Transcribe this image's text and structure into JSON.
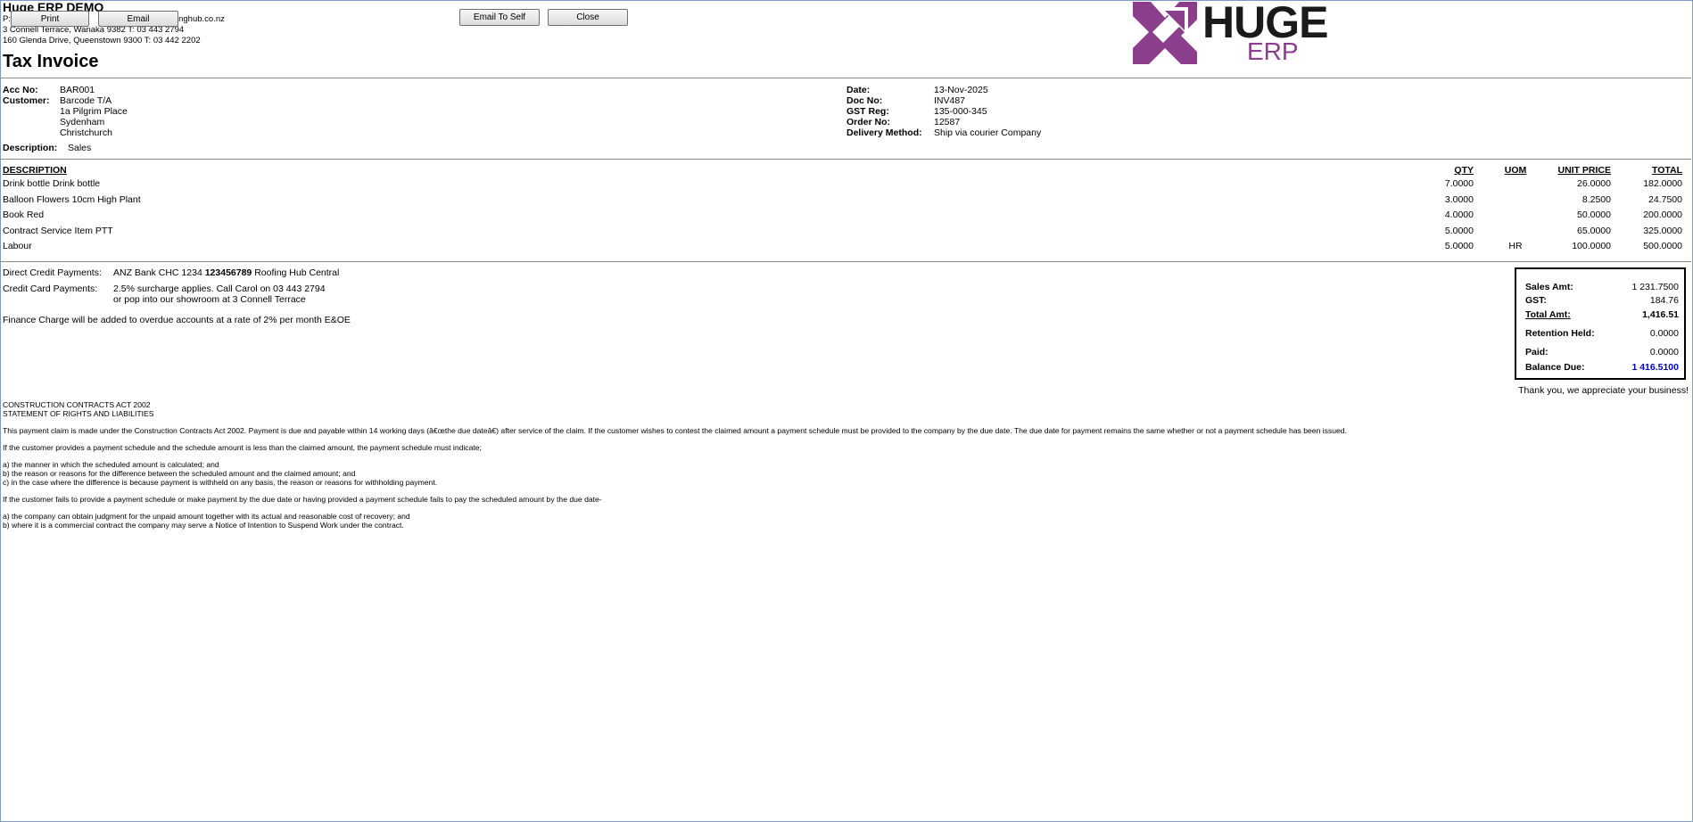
{
  "company": {
    "name": "Huge ERP DEMO",
    "line1_prefix": "P:",
    "line1_email": "inghub.co.nz",
    "line2": "3 Connell Terrace, Wanaka 9382  T: 03 443 2794",
    "line3": "160 Glenda Drive, Queenstown 9300  T: 03 442 2202"
  },
  "toolbar": {
    "print_label": "Print",
    "email_label": "Email",
    "email_self_label": "Email To Self",
    "close_label": "Close"
  },
  "logo": {
    "word1": "HUGE",
    "word2": "ERP",
    "brand_color": "#8b3e8b",
    "text_color": "#1a1a1a"
  },
  "doc_title": "Tax Invoice",
  "header_left": {
    "acc_label": "Acc No:",
    "acc_value": "BAR001",
    "customer_label": "Customer:",
    "customer_lines": [
      "Barcode T/A",
      "1a Pilgrim Place",
      "Sydenham",
      "Christchurch"
    ],
    "description_label": "Description:",
    "description_value": "Sales"
  },
  "header_right": {
    "date_label": "Date:",
    "date_value": "13-Nov-2025",
    "doc_label": "Doc No:",
    "doc_value": "INV487",
    "gst_label": "GST Reg:",
    "gst_value": "135-000-345",
    "order_label": "Order No:",
    "order_value": "12587",
    "delivery_label": "Delivery Method:",
    "delivery_value": "Ship via courier Company"
  },
  "table": {
    "headers": {
      "description": "DESCRIPTION",
      "qty": "QTY",
      "uom": "UOM",
      "unit_price": "UNIT PRICE",
      "total": "TOTAL"
    },
    "rows": [
      {
        "description": "Drink bottle Drink bottle",
        "qty": "7.0000",
        "uom": "",
        "unit_price": "26.0000",
        "total": "182.0000"
      },
      {
        "description": "Balloon Flowers 10cm High Plant",
        "qty": "3.0000",
        "uom": "",
        "unit_price": "8.2500",
        "total": "24.7500"
      },
      {
        "description": "Book Red",
        "qty": "4.0000",
        "uom": "",
        "unit_price": "50.0000",
        "total": "200.0000"
      },
      {
        "description": "Contract Service Item PTT",
        "qty": "5.0000",
        "uom": "",
        "unit_price": "65.0000",
        "total": "325.0000"
      },
      {
        "description": "Labour",
        "qty": "5.0000",
        "uom": "HR",
        "unit_price": "100.0000",
        "total": "500.0000"
      }
    ]
  },
  "payments": {
    "direct_label": "Direct Credit Payments:",
    "direct_pre": "ANZ Bank CHC 1234 ",
    "direct_bold": "123456789",
    "direct_post": " Roofing Hub Central",
    "card_label": "Credit Card Payments:",
    "card_line1": "2.5% surcharge applies. Call Carol on 03 443 2794",
    "card_line2": "or pop into our showroom at 3 Connell Terrace",
    "finance_note": "Finance Charge will be added to overdue accounts at a rate of 2% per month E&OE"
  },
  "totals": {
    "sales_label": "Sales Amt:",
    "sales_value": "1 231.7500",
    "gst_label": "GST:",
    "gst_value": "184.76",
    "total_label": "Total Amt:",
    "total_value": "1,416.51",
    "retention_label": "Retention Held:",
    "retention_value": "0.0000",
    "paid_label": "Paid:",
    "paid_value": "0.0000",
    "balance_label": "Balance Due:",
    "balance_value": "1 416.5100",
    "balance_color": "#0000cc",
    "thank_you": "Thank you, we appreciate your business!"
  },
  "legal": {
    "heading1": "CONSTRUCTION CONTRACTS ACT 2002",
    "heading2": "STATEMENT OF RIGHTS AND LIABILITIES",
    "p1": "This payment claim is made under the Construction Contracts Act 2002. Payment is due and payable within 14 working days (â€œthe due dateâ€) after service of the claim. If the customer wishes to contest the claimed amount a payment schedule must be provided to the company by the due date. The due date for payment remains the same whether or not a payment schedule has been issued.",
    "p2": "If the customer provides a payment schedule and the schedule amount is less than the claimed amount, the payment schedule must indicate;",
    "p3a": "a) the manner in which the scheduled amount is calculated; and",
    "p3b": "b) the reason or reasons for the difference between the scheduled amount and the claimed amount; and",
    "p3c": "c) in the case where the difference is because payment is withheld on any basis, the reason or reasons for withholding payment.",
    "p4": "If the customer fails to provide a payment schedule or make payment by the due date or having provided a payment schedule fails to pay the scheduled amount by the due date-",
    "p5a": "a) the company can obtain judgment for the unpaid amount together with its actual and reasonable cost of recovery; and",
    "p5b": "b) where it is a commercial contract the company may serve a Notice of Intention to Suspend Work under the contract."
  }
}
